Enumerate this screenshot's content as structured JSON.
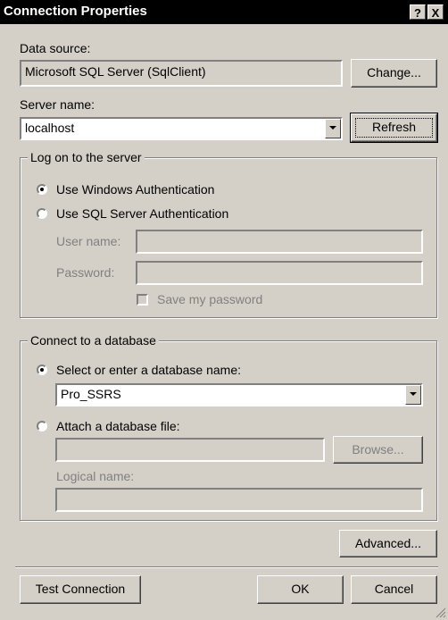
{
  "window": {
    "title": "Connection Properties",
    "help_label": "?",
    "close_label": "X"
  },
  "data_source": {
    "label": "Data source:",
    "value": "Microsoft SQL Server (SqlClient)",
    "change_label": "Change..."
  },
  "server": {
    "label": "Server name:",
    "value": "localhost",
    "refresh_label": "Refresh"
  },
  "logon": {
    "group_title": "Log on to the server",
    "windows_auth_label": "Use Windows Authentication",
    "sql_auth_label": "Use SQL Server Authentication",
    "selected": "windows",
    "username_label": "User name:",
    "username_value": "",
    "password_label": "Password:",
    "password_value": "",
    "save_password_label": "Save my password"
  },
  "database": {
    "group_title": "Connect to a database",
    "select_label": "Select or enter a database name:",
    "db_value": "Pro_SSRS",
    "attach_label": "Attach a database file:",
    "attach_value": "",
    "browse_label": "Browse...",
    "logical_label": "Logical name:",
    "logical_value": "",
    "selected": "select"
  },
  "buttons": {
    "advanced_label": "Advanced...",
    "test_label": "Test Connection",
    "ok_label": "OK",
    "cancel_label": "Cancel"
  }
}
